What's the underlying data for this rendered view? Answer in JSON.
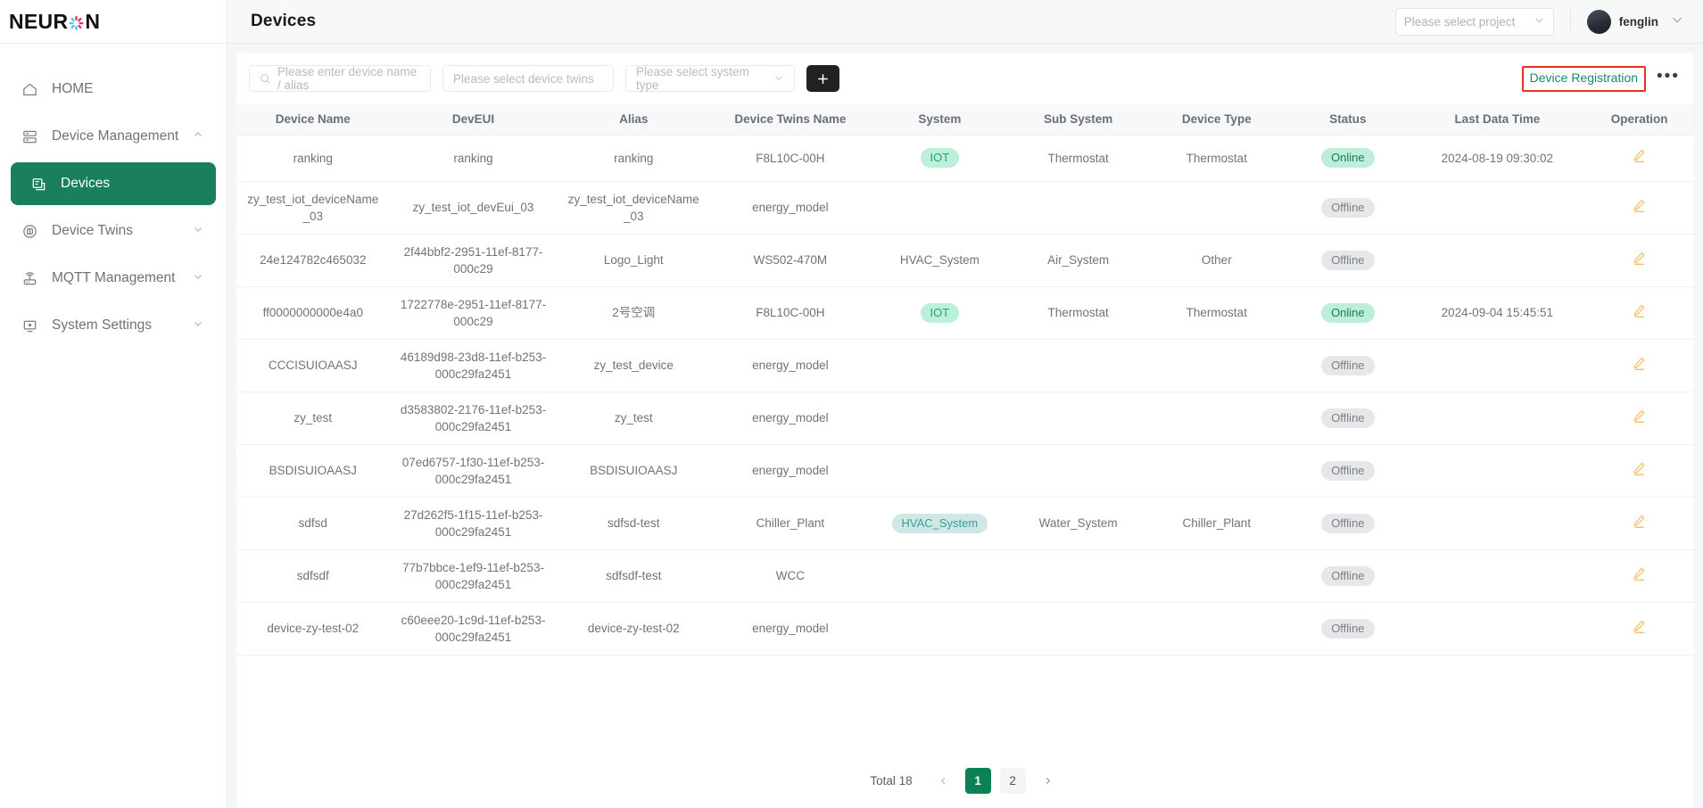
{
  "brand": {
    "name_part1": "NEUR",
    "name_part2": "N",
    "asterisk_icon": "asterisk-logo-icon"
  },
  "sidebar": {
    "items": [
      {
        "label": "HOME",
        "icon": "home-icon",
        "active": false,
        "caret": "",
        "sub": false
      },
      {
        "label": "Device Management",
        "icon": "server-rack-icon",
        "active": false,
        "caret": "up",
        "sub": false
      },
      {
        "label": "Devices",
        "icon": "device-card-icon",
        "active": true,
        "caret": "",
        "sub": true
      },
      {
        "label": "Device Twins",
        "icon": "twins-circle-icon",
        "active": false,
        "caret": "down",
        "sub": false
      },
      {
        "label": "MQTT Management",
        "icon": "router-icon",
        "active": false,
        "caret": "down",
        "sub": false
      },
      {
        "label": "System Settings",
        "icon": "monitor-icon",
        "active": false,
        "caret": "down",
        "sub": false
      }
    ]
  },
  "topbar": {
    "title": "Devices",
    "project_select_placeholder": "Please select project",
    "user_name": "fenglin"
  },
  "filters": {
    "search_placeholder": "Please enter device name / alias",
    "device_twins_placeholder": "Please select device twins",
    "system_type_placeholder": "Please select system type",
    "add_button_label": "+",
    "device_registration_label": "Device Registration",
    "more_label": "•••"
  },
  "colors": {
    "accent_green": "#1a7f5f",
    "link_green": "#1a8a63",
    "highlight_red": "#e8301e",
    "badge_iot_bg": "#bdf0d9",
    "badge_hvac_bg": "#cfe7e5",
    "badge_online_bg": "#bdeed9",
    "badge_offline_bg": "#e6e7e9",
    "pager_active_bg": "#0b8256"
  },
  "table": {
    "columns": [
      "Device Name",
      "DevEUI",
      "Alias",
      "Device Twins Name",
      "System",
      "Sub System",
      "Device Type",
      "Status",
      "Last Data Time",
      "Operation"
    ],
    "rows": [
      {
        "device_name": "ranking",
        "deveui": "ranking",
        "alias": "ranking",
        "twins_name": "F8L10C-00H",
        "system": "IOT",
        "system_style": "iot",
        "sub_system": "Thermostat",
        "device_type": "Thermostat",
        "status": "Online",
        "status_style": "online",
        "last_data_time": "2024-08-19 09:30:02"
      },
      {
        "device_name": "zy_test_iot_deviceName_03",
        "deveui": "zy_test_iot_devEui_03",
        "alias": "zy_test_iot_deviceName_03",
        "twins_name": "energy_model",
        "system": "",
        "system_style": "none",
        "sub_system": "",
        "device_type": "",
        "status": "Offline",
        "status_style": "offline",
        "last_data_time": ""
      },
      {
        "device_name": "24e124782c465032",
        "deveui": "2f44bbf2-2951-11ef-8177-000c29",
        "alias": "Logo_Light",
        "twins_name": "WS502-470M",
        "system": "HVAC_System",
        "system_style": "plain",
        "sub_system": "Air_System",
        "device_type": "Other",
        "status": "Offline",
        "status_style": "offline",
        "last_data_time": ""
      },
      {
        "device_name": "ff0000000000e4a0",
        "deveui": "1722778e-2951-11ef-8177-000c29",
        "alias": "2号空调",
        "twins_name": "F8L10C-00H",
        "system": "IOT",
        "system_style": "iot",
        "sub_system": "Thermostat",
        "device_type": "Thermostat",
        "status": "Online",
        "status_style": "online",
        "last_data_time": "2024-09-04 15:45:51"
      },
      {
        "device_name": "CCCISUIOAASJ",
        "deveui": "46189d98-23d8-11ef-b253-000c29fa2451",
        "alias": "zy_test_device",
        "twins_name": "energy_model",
        "system": "",
        "system_style": "none",
        "sub_system": "",
        "device_type": "",
        "status": "Offline",
        "status_style": "offline",
        "last_data_time": ""
      },
      {
        "device_name": "zy_test",
        "deveui": "d3583802-2176-11ef-b253-000c29fa2451",
        "alias": "zy_test",
        "twins_name": "energy_model",
        "system": "",
        "system_style": "none",
        "sub_system": "",
        "device_type": "",
        "status": "Offline",
        "status_style": "offline",
        "last_data_time": ""
      },
      {
        "device_name": "BSDISUIOAASJ",
        "deveui": "07ed6757-1f30-11ef-b253-000c29fa2451",
        "alias": "BSDISUIOAASJ",
        "twins_name": "energy_model",
        "system": "",
        "system_style": "none",
        "sub_system": "",
        "device_type": "",
        "status": "Offline",
        "status_style": "offline",
        "last_data_time": ""
      },
      {
        "device_name": "sdfsd",
        "deveui": "27d262f5-1f15-11ef-b253-000c29fa2451",
        "alias": "sdfsd-test",
        "twins_name": "Chiller_Plant",
        "system": "HVAC_System",
        "system_style": "hvac",
        "sub_system": "Water_System",
        "device_type": "Chiller_Plant",
        "status": "Offline",
        "status_style": "offline",
        "last_data_time": ""
      },
      {
        "device_name": "sdfsdf",
        "deveui": "77b7bbce-1ef9-11ef-b253-000c29fa2451",
        "alias": "sdfsdf-test",
        "twins_name": "WCC",
        "system": "",
        "system_style": "none",
        "sub_system": "",
        "device_type": "",
        "status": "Offline",
        "status_style": "offline",
        "last_data_time": ""
      },
      {
        "device_name": "device-zy-test-02",
        "deveui": "c60eee20-1c9d-11ef-b253-000c29fa2451",
        "alias": "device-zy-test-02",
        "twins_name": "energy_model",
        "system": "",
        "system_style": "none",
        "sub_system": "",
        "device_type": "",
        "status": "Offline",
        "status_style": "offline",
        "last_data_time": ""
      }
    ],
    "operation_icon": "edit-pencil-icon"
  },
  "pagination": {
    "total_label": "Total 18",
    "prev_icon": "chevron-left-icon",
    "next_icon": "chevron-right-icon",
    "pages": [
      "1",
      "2"
    ],
    "current_page": "1"
  }
}
